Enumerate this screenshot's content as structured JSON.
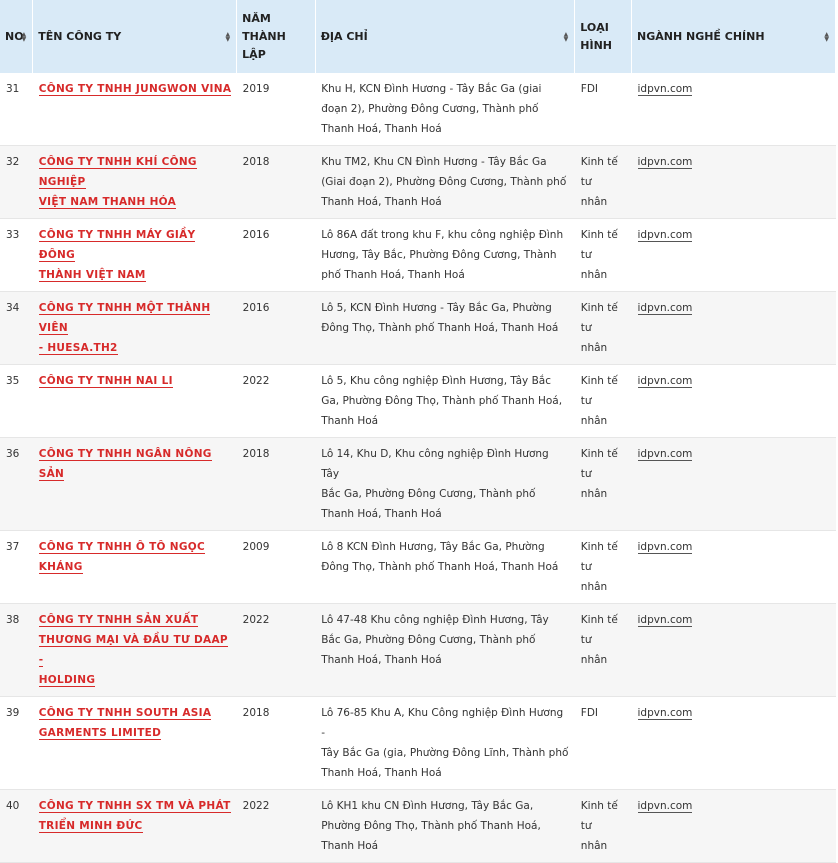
{
  "headers": {
    "no": "NO",
    "name": "TÊN CÔNG TY",
    "year_line1": "NĂM",
    "year_line2": "THÀNH",
    "year_line3": "LẬP",
    "address": "ĐỊA CHỈ",
    "type_line1": "LOẠI",
    "type_line2": "HÌNH",
    "industry": "NGÀNH NGHỀ CHÍNH"
  },
  "rows": [
    {
      "no": "31",
      "name_lines": [
        "CÔNG TY TNHH JUNGWON VINA"
      ],
      "year": "2019",
      "address_lines": [
        "Khu H, KCN Đình Hương - Tây Bắc Ga (giai",
        "đoạn 2), Phường Đông Cương, Thành phố",
        "Thanh Hoá, Thanh Hoá"
      ],
      "type_lines": [
        "FDI"
      ],
      "website": "idpvn.com"
    },
    {
      "no": "32",
      "name_lines": [
        "CÔNG TY TNHH KHÍ CÔNG NGHIỆP",
        "VIỆT NAM THANH HÓA"
      ],
      "year": "2018",
      "address_lines": [
        "Khu TM2, Khu CN Đình Hương - Tây Bắc Ga",
        "(Giai đoạn 2), Phường Đông Cương, Thành phố",
        "Thanh Hoá, Thanh Hoá"
      ],
      "type_lines": [
        "Kinh tế tư",
        "nhân"
      ],
      "website": "idpvn.com"
    },
    {
      "no": "33",
      "name_lines": [
        "CÔNG TY TNHH MÁY GIẦY ĐÔNG",
        "THÀNH VIỆT NAM"
      ],
      "year": "2016",
      "address_lines": [
        "Lô 86A đất trong khu F, khu công nghiệp Đình",
        "Hương, Tây Bắc, Phường Đông Cương, Thành",
        "phố Thanh Hoá, Thanh Hoá"
      ],
      "type_lines": [
        "Kinh tế tư",
        "nhân"
      ],
      "website": "idpvn.com"
    },
    {
      "no": "34",
      "name_lines": [
        "CÔNG TY TNHH MỘT THÀNH VIÊN",
        "- HUESA.TH2"
      ],
      "year": "2016",
      "address_lines": [
        "Lô 5, KCN Đình Hương - Tây Bắc Ga, Phường",
        "Đông Thọ, Thành phố Thanh Hoá, Thanh Hoá"
      ],
      "type_lines": [
        "Kinh tế tư",
        "nhân"
      ],
      "website": "idpvn.com"
    },
    {
      "no": "35",
      "name_lines": [
        "CÔNG TY TNHH NAI LI"
      ],
      "year": "2022",
      "address_lines": [
        "Lô 5, Khu công nghiệp Đình Hương, Tây Bắc",
        "Ga, Phường Đông Thọ, Thành phố Thanh Hoá,",
        "Thanh Hoá"
      ],
      "type_lines": [
        "Kinh tế tư",
        "nhân"
      ],
      "website": "idpvn.com"
    },
    {
      "no": "36",
      "name_lines": [
        "CÔNG TY TNHH NGÂN NÔNG SẢN"
      ],
      "year": "2018",
      "address_lines": [
        "Lô 14, Khu D, Khu công nghiệp Đình Hương Tây",
        "Bắc Ga, Phường Đông Cương, Thành phố",
        "Thanh Hoá, Thanh Hoá"
      ],
      "type_lines": [
        "Kinh tế tư",
        "nhân"
      ],
      "website": "idpvn.com"
    },
    {
      "no": "37",
      "name_lines": [
        "CÔNG TY TNHH Ô TÔ NGỌC",
        "KHÁNG"
      ],
      "year": "2009",
      "address_lines": [
        "Lô 8 KCN Đình Hương, Tây Bắc Ga, Phường",
        "Đông Thọ, Thành phố Thanh Hoá, Thanh Hoá"
      ],
      "type_lines": [
        "Kinh tế tư",
        "nhân"
      ],
      "website": "idpvn.com"
    },
    {
      "no": "38",
      "name_lines": [
        "CÔNG TY TNHH SẢN XUẤT",
        "THƯƠNG MẠI VÀ ĐẦU TƯ DAAP -",
        "HOLDING"
      ],
      "year": "2022",
      "address_lines": [
        "Lô 47-48 Khu công nghiệp Đình Hương, Tây",
        "Bắc Ga, Phường Đông Cương, Thành phố",
        "Thanh Hoá, Thanh Hoá"
      ],
      "type_lines": [
        "Kinh tế tư",
        "nhân"
      ],
      "website": "idpvn.com"
    },
    {
      "no": "39",
      "name_lines": [
        "CÔNG TY TNHH SOUTH ASIA",
        "GARMENTS LIMITED"
      ],
      "year": "2018",
      "address_lines": [
        "Lô 76-85 Khu A, Khu Công nghiệp Đình Hương -",
        "Tây Bắc Ga (gia, Phường Đông Lĩnh, Thành phố",
        "Thanh Hoá, Thanh Hoá"
      ],
      "type_lines": [
        "FDI"
      ],
      "website": "idpvn.com"
    },
    {
      "no": "40",
      "name_lines": [
        "CÔNG TY TNHH SX TM VÀ PHÁT",
        "TRIỂN MINH ĐỨC"
      ],
      "year": "2022",
      "address_lines": [
        "Lô KH1 khu CN Đình Hương, Tây Bắc Ga,",
        "Phường Đông Thọ, Thành phố Thanh Hoá,",
        "Thanh Hoá"
      ],
      "type_lines": [
        "Kinh tế tư",
        "nhân"
      ],
      "website": "idpvn.com"
    }
  ]
}
